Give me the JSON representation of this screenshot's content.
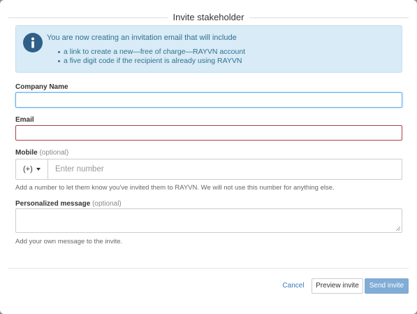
{
  "modal": {
    "title": "Invite stakeholder"
  },
  "info": {
    "icon": "info-icon",
    "lead": "You are now creating an invitation email that will include",
    "items": [
      "a link to create a new—free of charge—RAYVN account",
      "a five digit code if the recipient is already using RAYVN"
    ]
  },
  "form": {
    "company": {
      "label": "Company Name",
      "value": ""
    },
    "email": {
      "label": "Email",
      "value": ""
    },
    "mobile": {
      "label": "Mobile",
      "optional": "(optional)",
      "country_code": "(+)",
      "placeholder": "Enter number",
      "help": "Add a number to let them know you've invited them to RAYVN. We will not use this number for anything else."
    },
    "message": {
      "label": "Personalized message",
      "optional": "(optional)",
      "value": "",
      "help": "Add your own message to the invite."
    }
  },
  "footer": {
    "cancel_label": "Cancel",
    "preview_label": "Preview invite",
    "send_label": "Send invite"
  },
  "colors": {
    "info_bg": "#d8ebf6",
    "info_text": "#31708f",
    "focus_border": "#66afe9",
    "error_border": "#a94442",
    "primary_disabled": "#80acd6",
    "link": "#337ab7"
  }
}
